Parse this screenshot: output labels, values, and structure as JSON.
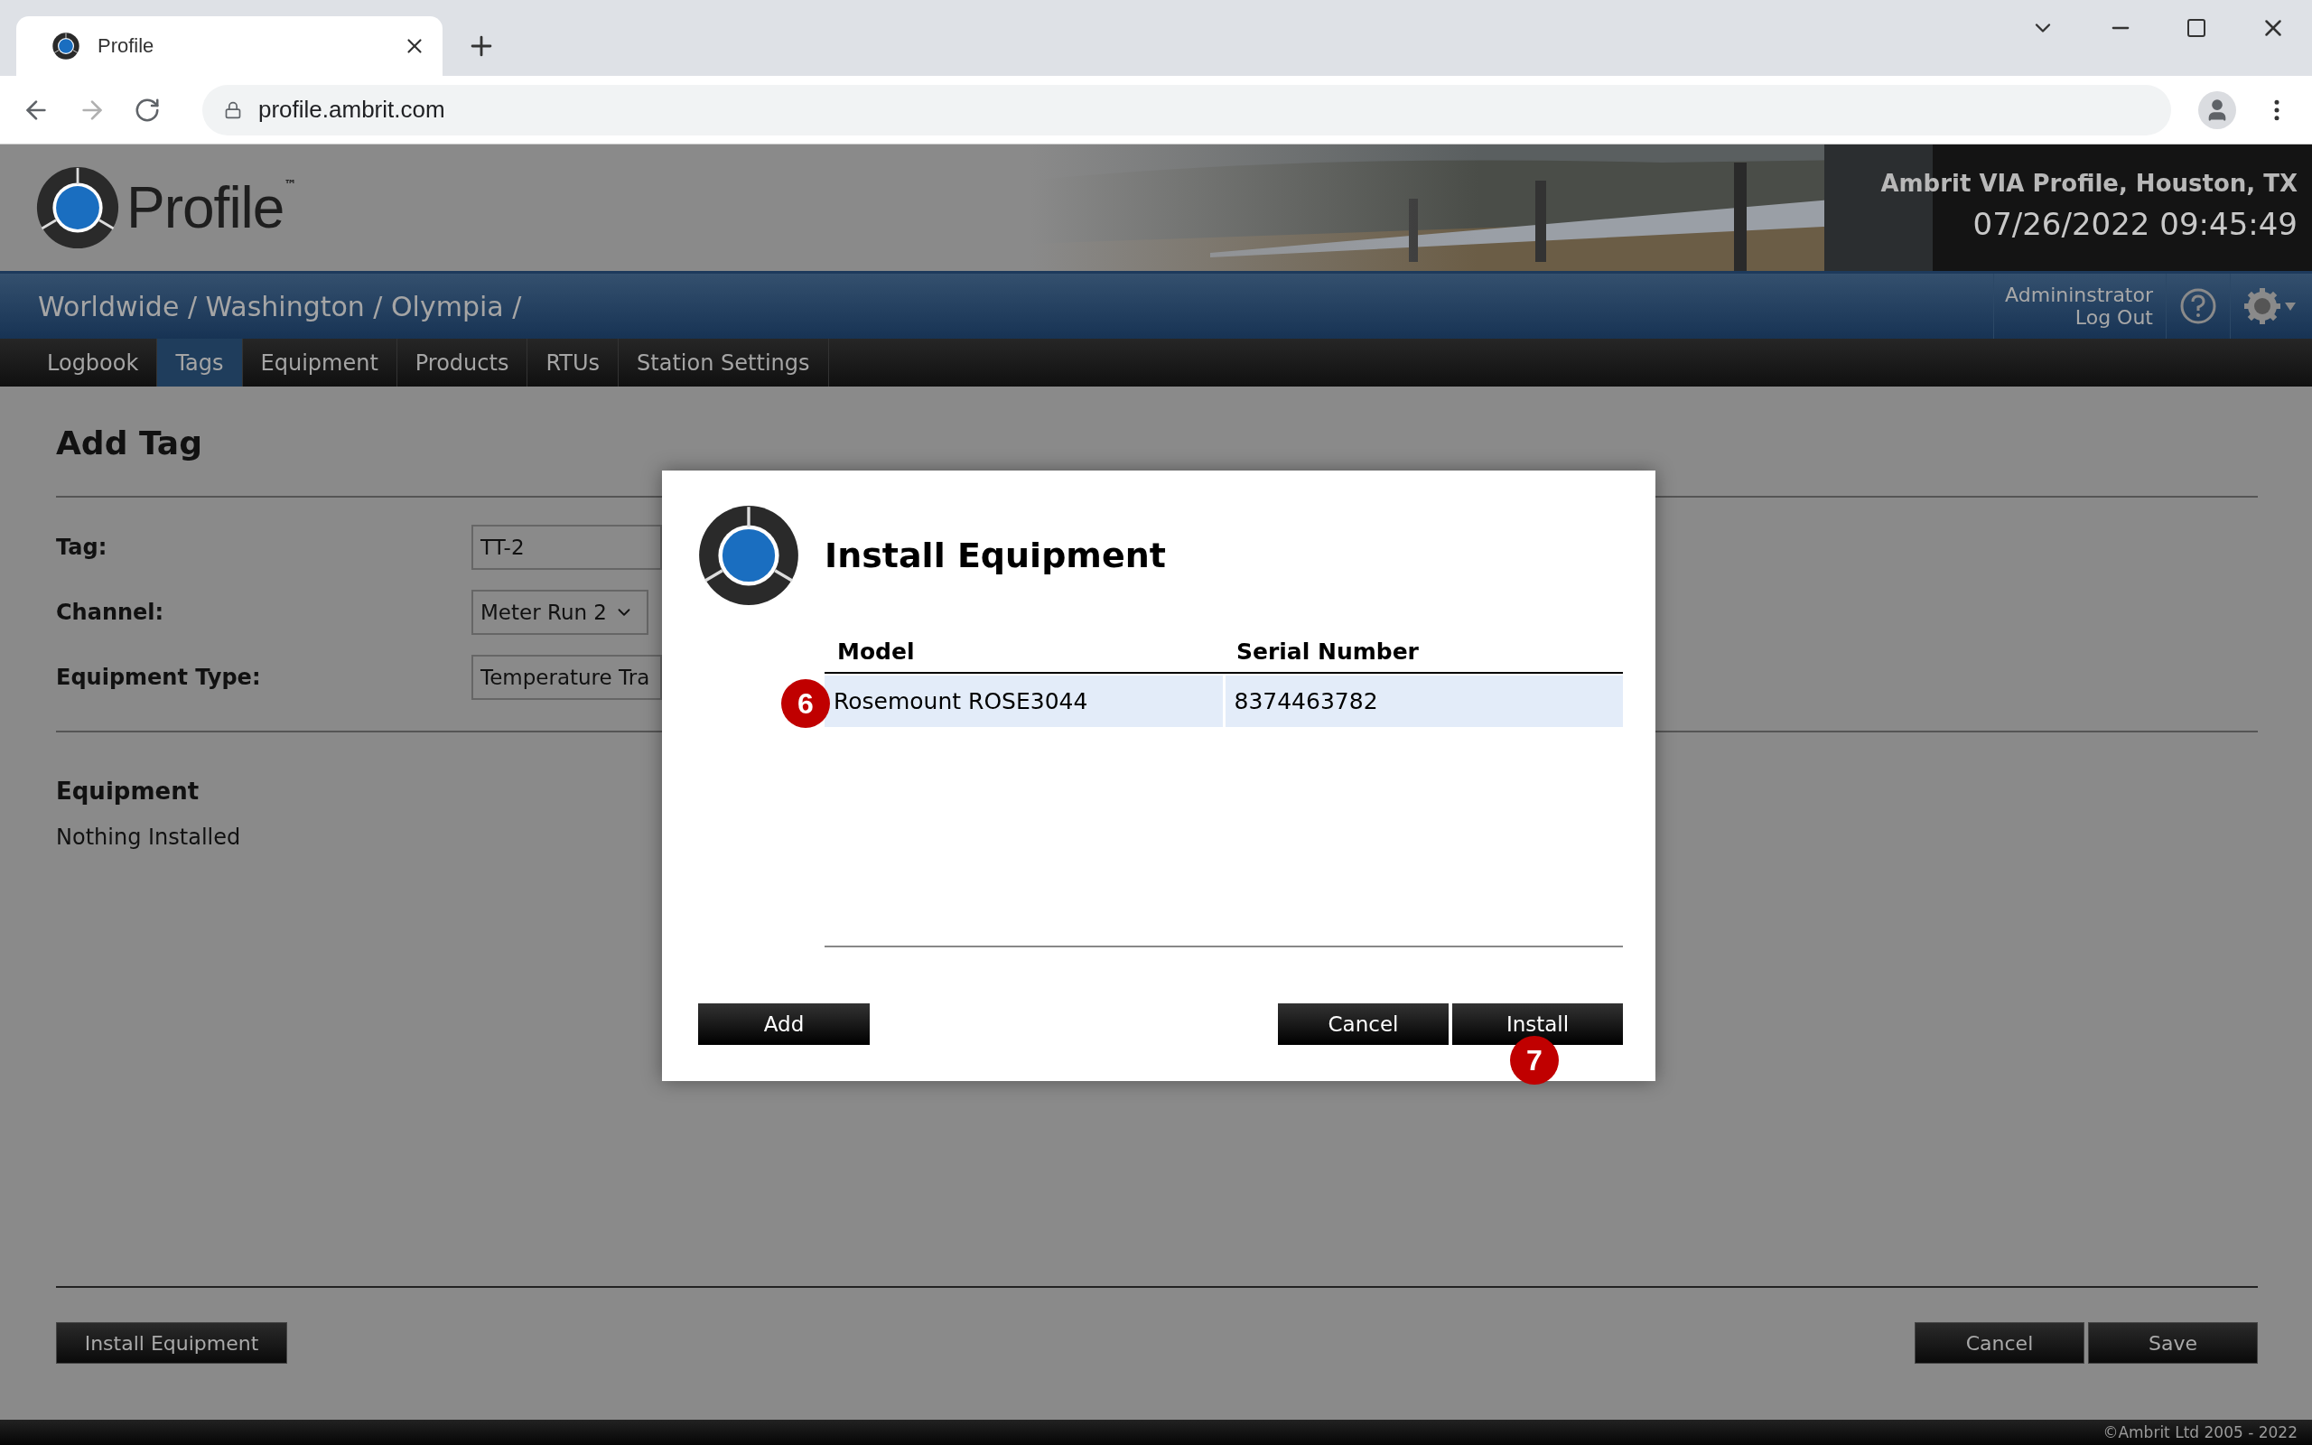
{
  "browser": {
    "tab_title": "Profile",
    "url": "profile.ambrit.com"
  },
  "header": {
    "logo_text": "Profile",
    "trademark": "™",
    "site": "Ambrit VIA Profile, Houston, TX",
    "datetime": "07/26/2022 09:45:49"
  },
  "breadcrumb": "Worldwide / Washington / Olympia /",
  "user": {
    "name": "Admininstrator",
    "logout": "Log Out"
  },
  "nav": [
    {
      "label": "Logbook",
      "selected": false
    },
    {
      "label": "Tags",
      "selected": true
    },
    {
      "label": "Equipment",
      "selected": false
    },
    {
      "label": "Products",
      "selected": false
    },
    {
      "label": "RTUs",
      "selected": false
    },
    {
      "label": "Station Settings",
      "selected": false
    }
  ],
  "page": {
    "title": "Add Tag",
    "fields": [
      {
        "label": "Tag:",
        "value": "TT-2",
        "kind": "text"
      },
      {
        "label": "Channel:",
        "value": "Meter Run 2",
        "kind": "select"
      },
      {
        "label": "Equipment Type:",
        "value": "Temperature Tra",
        "kind": "text"
      }
    ],
    "section_title": "Equipment",
    "section_text": "Nothing Installed",
    "left_button": "Install Equipment",
    "right_buttons": [
      "Cancel",
      "Save"
    ]
  },
  "dialog": {
    "title": "Install Equipment",
    "columns": [
      "Model",
      "Serial Number"
    ],
    "rows": [
      {
        "cells": [
          "Rosemount ROSE3044",
          "8374463782"
        ],
        "selected": true,
        "marker": "6"
      }
    ],
    "left_button": "Add",
    "right_buttons": [
      {
        "label": "Cancel"
      },
      {
        "label": "Install",
        "marker": "7"
      }
    ]
  },
  "footer": "©Ambrit Ltd 2005 - 2022"
}
